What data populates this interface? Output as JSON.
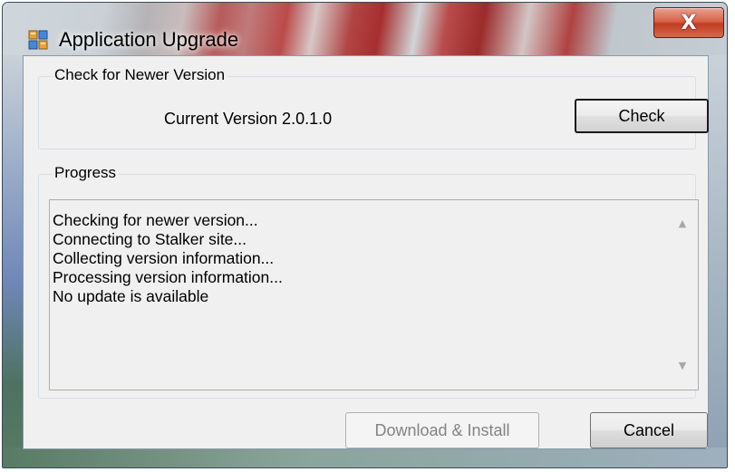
{
  "window": {
    "title": "Application Upgrade",
    "close_glyph": "X"
  },
  "check_group": {
    "legend": "Check for Newer Version",
    "current_version": "Current Version 2.0.1.0",
    "check_button": "Check"
  },
  "progress_group": {
    "legend": "Progress",
    "log_lines": [
      "Checking for newer version...",
      "Connecting to Stalker site...",
      "Collecting version information...",
      "Processing version information...",
      "No update is available"
    ]
  },
  "footer": {
    "download_button": "Download & Install",
    "download_enabled": false,
    "cancel_button": "Cancel"
  },
  "icons": {
    "app": "application-window-icon",
    "scroll_up": "scroll-up-arrow-icon",
    "scroll_down": "scroll-down-arrow-icon"
  },
  "colors": {
    "close_button": "#c8432a",
    "client_background": "#f0f0f0",
    "disabled_text": "#838383"
  }
}
